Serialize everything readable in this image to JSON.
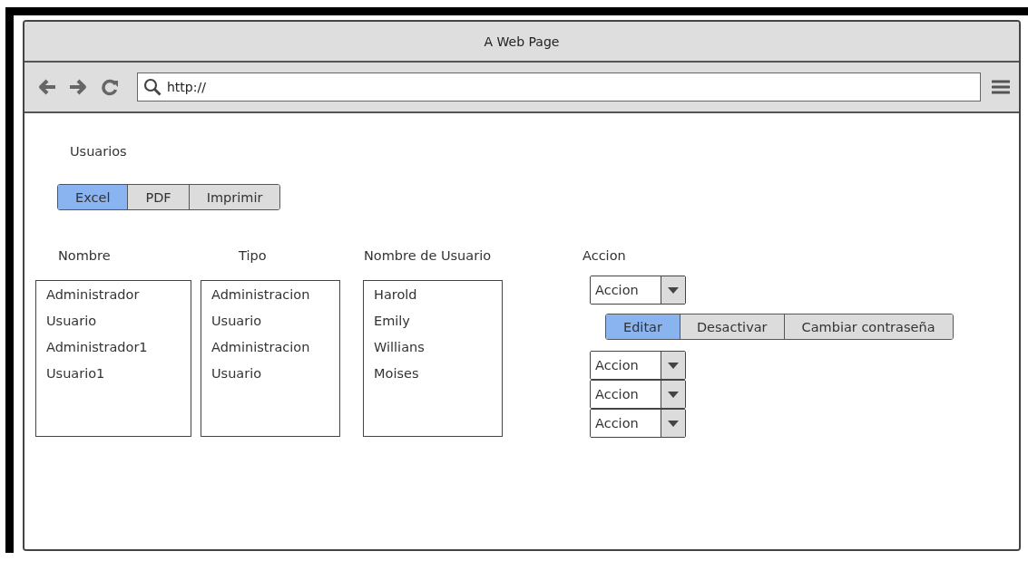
{
  "window": {
    "title": "A Web Page"
  },
  "browser": {
    "url": "http://"
  },
  "page": {
    "title": "Usuarios",
    "export_buttons": [
      {
        "label": "Excel",
        "selected": true
      },
      {
        "label": "PDF",
        "selected": false
      },
      {
        "label": "Imprimir",
        "selected": false
      }
    ],
    "columns": [
      {
        "header": "Nombre",
        "items": [
          "Administrador",
          "Usuario",
          "Administrador1",
          "Usuario1"
        ]
      },
      {
        "header": "Tipo",
        "items": [
          "Administracion",
          "Usuario",
          "Administracion",
          "Usuario"
        ]
      },
      {
        "header": "Nombre de Usuario",
        "items": [
          "Harold",
          "Emily",
          "Willians",
          "Moises"
        ]
      }
    ],
    "action": {
      "header": "Accion",
      "rows": [
        {
          "kind": "dropdown",
          "value": "Accion"
        },
        {
          "kind": "button_group",
          "buttons": [
            {
              "label": "Editar",
              "selected": true
            },
            {
              "label": "Desactivar",
              "selected": false
            },
            {
              "label": "Cambiar contraseña",
              "selected": false
            }
          ]
        },
        {
          "kind": "dropdown",
          "value": "Accion"
        },
        {
          "kind": "dropdown",
          "value": "Accion"
        },
        {
          "kind": "dropdown",
          "value": "Accion"
        }
      ]
    }
  }
}
